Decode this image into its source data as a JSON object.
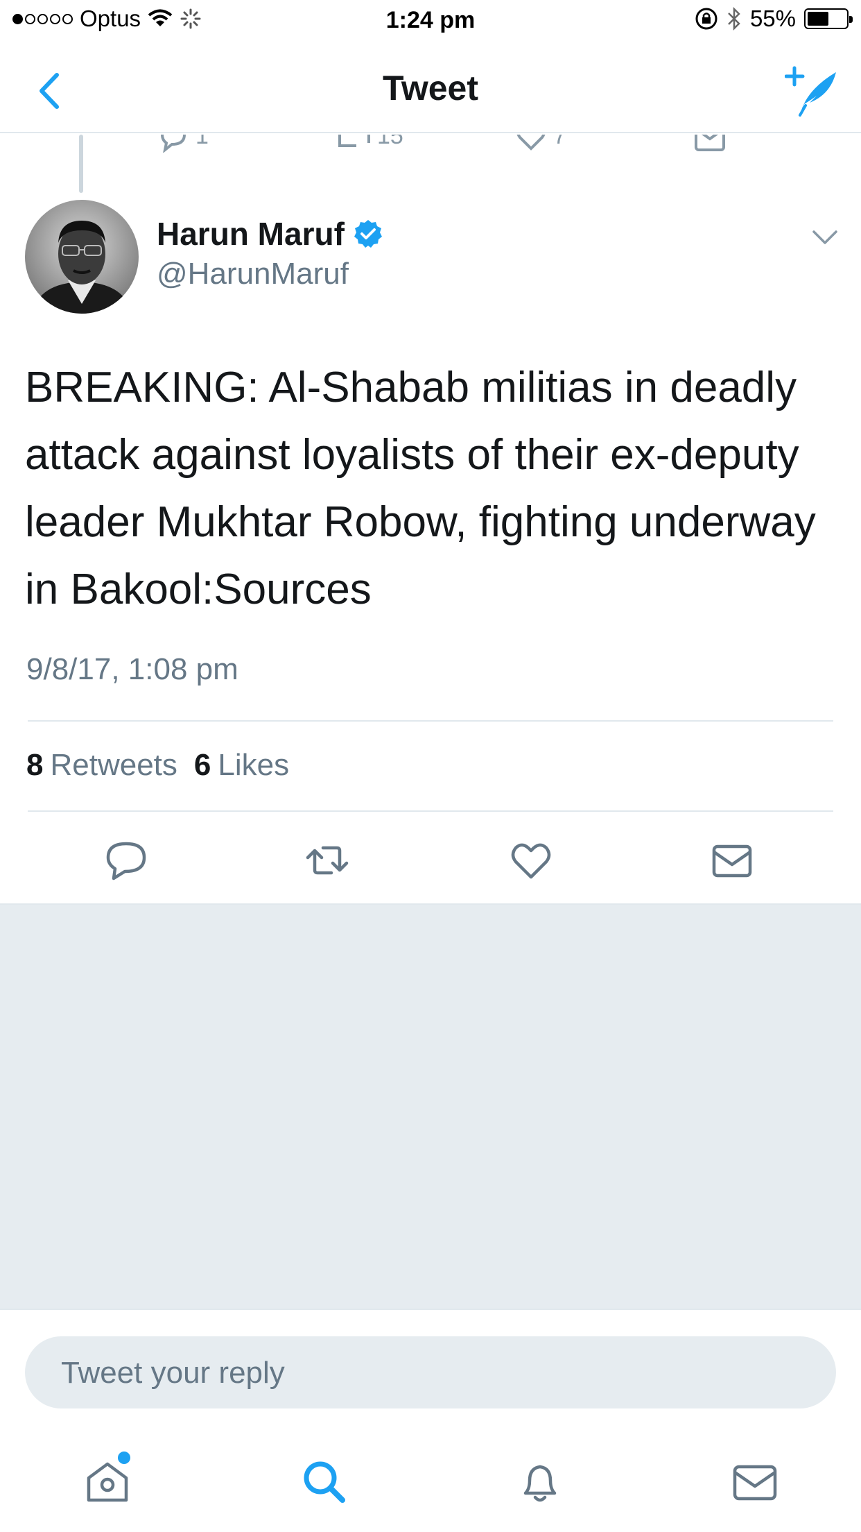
{
  "status_bar": {
    "carrier": "Optus",
    "time": "1:24 pm",
    "battery": "55%",
    "battery_level": 0.55
  },
  "nav": {
    "title": "Tweet",
    "back_icon": "chevron-left-icon",
    "compose_icon": "compose-tweet-icon"
  },
  "previous_tweet": {
    "reply_count": "1",
    "retweet_count": "15",
    "like_count": "7"
  },
  "tweet": {
    "author_name": "Harun Maruf",
    "author_handle": "@HarunMaruf",
    "verified": true,
    "text": "BREAKING: Al-Shabab militias in deadly attack against loyalists of their ex-deputy leader Mukhtar Robow, fighting underway in Bakool:Sources",
    "timestamp": "9/8/17, 1:08 pm",
    "retweets_count": "8",
    "retweets_label": "Retweets",
    "likes_count": "6",
    "likes_label": "Likes"
  },
  "reply": {
    "placeholder": "Tweet your reply"
  },
  "tab_bar": {
    "items": [
      "home-icon",
      "search-icon",
      "notifications-icon",
      "messages-icon"
    ]
  },
  "colors": {
    "accent": "#1da1f2",
    "text_primary": "#14171a",
    "text_secondary": "#657786",
    "divider": "#e1e8ed",
    "background_gray": "#e6ecf0"
  }
}
